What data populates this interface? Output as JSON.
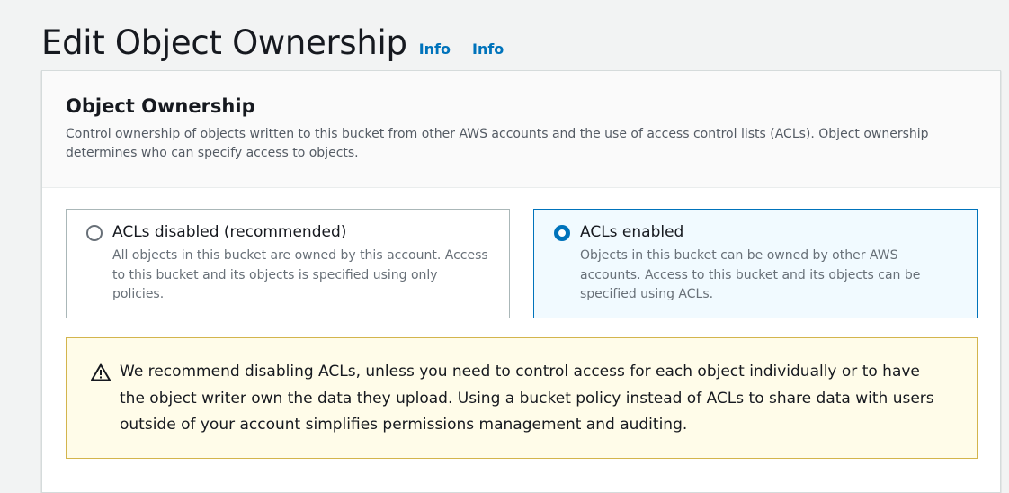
{
  "header": {
    "title": "Edit Object Ownership",
    "info_links": [
      "Info",
      "Info"
    ]
  },
  "section": {
    "title": "Object Ownership",
    "description": "Control ownership of objects written to this bucket from other AWS accounts and the use of access control lists (ACLs). Object ownership determines who can specify access to objects."
  },
  "options": [
    {
      "label": "ACLs disabled (recommended)",
      "description": "All objects in this bucket are owned by this account. Access to this bucket and its objects is specified using only policies.",
      "selected": false
    },
    {
      "label": "ACLs enabled",
      "description": "Objects in this bucket can be owned by other AWS accounts. Access to this bucket and its objects can be specified using ACLs.",
      "selected": true
    }
  ],
  "alert": {
    "type": "warning",
    "icon": "warning-icon",
    "text": "We recommend disabling ACLs, unless you need to control access for each object individually or to have the object writer own the data they upload. Using a bucket policy instead of ACLs to share data with users outside of your account simplifies permissions management and auditing."
  },
  "colors": {
    "accent": "#0073bb",
    "warning_border": "#d3b54d",
    "warning_bg": "#fffce9"
  }
}
